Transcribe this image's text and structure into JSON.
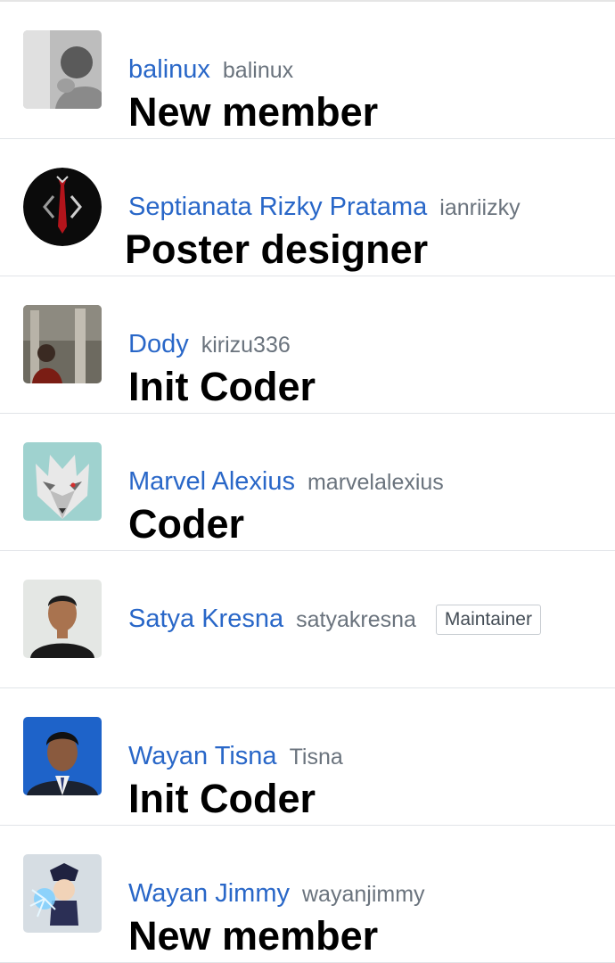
{
  "members": [
    {
      "name": "balinux",
      "login": "balinux",
      "bio": "New member"
    },
    {
      "name": "Septianata Rizky Pratama",
      "login": "ianriizky",
      "bio": "Poster designer"
    },
    {
      "name": "Dody",
      "login": "kirizu336",
      "bio": "Init Coder"
    },
    {
      "name": "Marvel Alexius",
      "login": "marvelalexius",
      "bio": "Coder"
    },
    {
      "name": "Satya Kresna",
      "login": "satyakresna",
      "bio": "",
      "badge": "Maintainer"
    },
    {
      "name": "Wayan Tisna",
      "login": "Tisna",
      "bio": "Init Coder"
    },
    {
      "name": "Wayan Jimmy",
      "login": "wayanjimmy",
      "bio": "New member"
    }
  ],
  "colors": {
    "link": "#2967c8",
    "muted": "#6a737d",
    "divider": "#e1e4e8"
  }
}
